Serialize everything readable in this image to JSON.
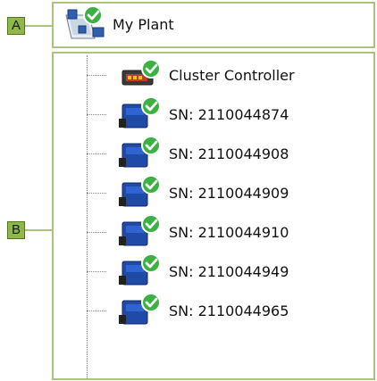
{
  "callouts": {
    "a": "A",
    "b": "B"
  },
  "root": {
    "label": "My Plant",
    "icon": "plant-status-ok-icon"
  },
  "items": [
    {
      "label": "Cluster Controller",
      "icon": "cluster-controller-status-ok-icon"
    },
    {
      "label": "SN: 2110044874",
      "icon": "inverter-status-ok-icon"
    },
    {
      "label": "SN: 2110044908",
      "icon": "inverter-status-ok-icon"
    },
    {
      "label": "SN: 2110044909",
      "icon": "inverter-status-ok-icon"
    },
    {
      "label": "SN: 2110044910",
      "icon": "inverter-status-ok-icon"
    },
    {
      "label": "SN: 2110044949",
      "icon": "inverter-status-ok-icon"
    },
    {
      "label": "SN: 2110044965",
      "icon": "inverter-status-ok-icon"
    }
  ],
  "colors": {
    "frame": "#a9c47f",
    "callout_fill": "#8fb84b",
    "status_ok": "#3cb043",
    "inverter_blue": "#1f4aa8"
  }
}
